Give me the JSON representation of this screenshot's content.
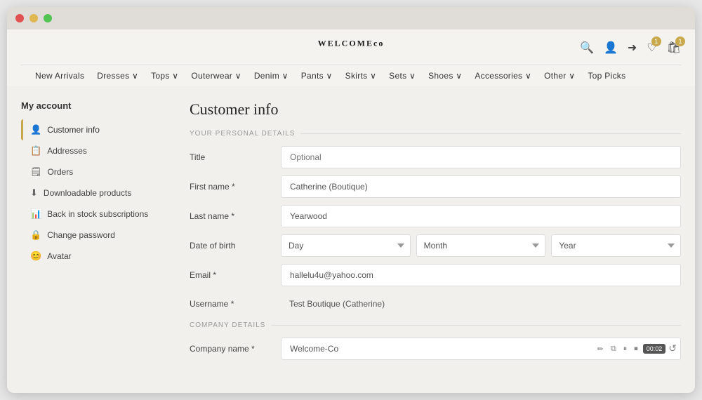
{
  "browser": {
    "buttons": [
      "red",
      "yellow",
      "green"
    ]
  },
  "header": {
    "logo": "WELCOME",
    "logo_suffix": "co",
    "icons": {
      "search": "🔍",
      "user": "👤",
      "arrow": "➜",
      "wishlist": "♡",
      "cart": "🛍"
    },
    "wishlist_badge": "1",
    "cart_badge": "1"
  },
  "nav": {
    "items": [
      {
        "label": "New Arrivals"
      },
      {
        "label": "Dresses ∨"
      },
      {
        "label": "Tops ∨"
      },
      {
        "label": "Outerwear ∨"
      },
      {
        "label": "Denim ∨"
      },
      {
        "label": "Pants ∨"
      },
      {
        "label": "Skirts ∨"
      },
      {
        "label": "Sets ∨"
      },
      {
        "label": "Shoes ∨"
      },
      {
        "label": "Accessories ∨"
      },
      {
        "label": "Other ∨"
      },
      {
        "label": "Top Picks"
      }
    ]
  },
  "sidebar": {
    "title": "My account",
    "items": [
      {
        "label": "Customer info",
        "icon": "👤",
        "active": true
      },
      {
        "label": "Addresses",
        "icon": "📋"
      },
      {
        "label": "Orders",
        "icon": "🗒"
      },
      {
        "label": "Downloadable products",
        "icon": "⬇"
      },
      {
        "label": "Back in stock subscriptions",
        "icon": "📊"
      },
      {
        "label": "Change password",
        "icon": "🔒"
      },
      {
        "label": "Avatar",
        "icon": "😊"
      }
    ]
  },
  "page": {
    "title": "Customer info",
    "personal_section_label": "YOUR PERSONAL DETAILS",
    "company_section_label": "COMPANY DETAILS",
    "fields": {
      "title": {
        "label": "Title",
        "placeholder": "Optional",
        "value": ""
      },
      "first_name": {
        "label": "First name *",
        "placeholder": "",
        "value": "Catherine (Boutique)"
      },
      "last_name": {
        "label": "Last name *",
        "placeholder": "",
        "value": "Yearwood"
      },
      "date_of_birth": {
        "label": "Date of birth",
        "day_placeholder": "Day",
        "month_placeholder": "Month",
        "year_placeholder": "Year"
      },
      "email": {
        "label": "Email *",
        "placeholder": "",
        "value": "hallelu4u@yahoo.com"
      },
      "username": {
        "label": "Username *",
        "value": "Test Boutique (Catherine)"
      },
      "company_name": {
        "label": "Company name *",
        "value": "Welcome-Co"
      }
    },
    "company_toolbar": {
      "edit": "✏",
      "copy": "⧉",
      "pause": "⏸",
      "stop": "⏹",
      "timer": "00:02",
      "refresh": "↺"
    }
  }
}
